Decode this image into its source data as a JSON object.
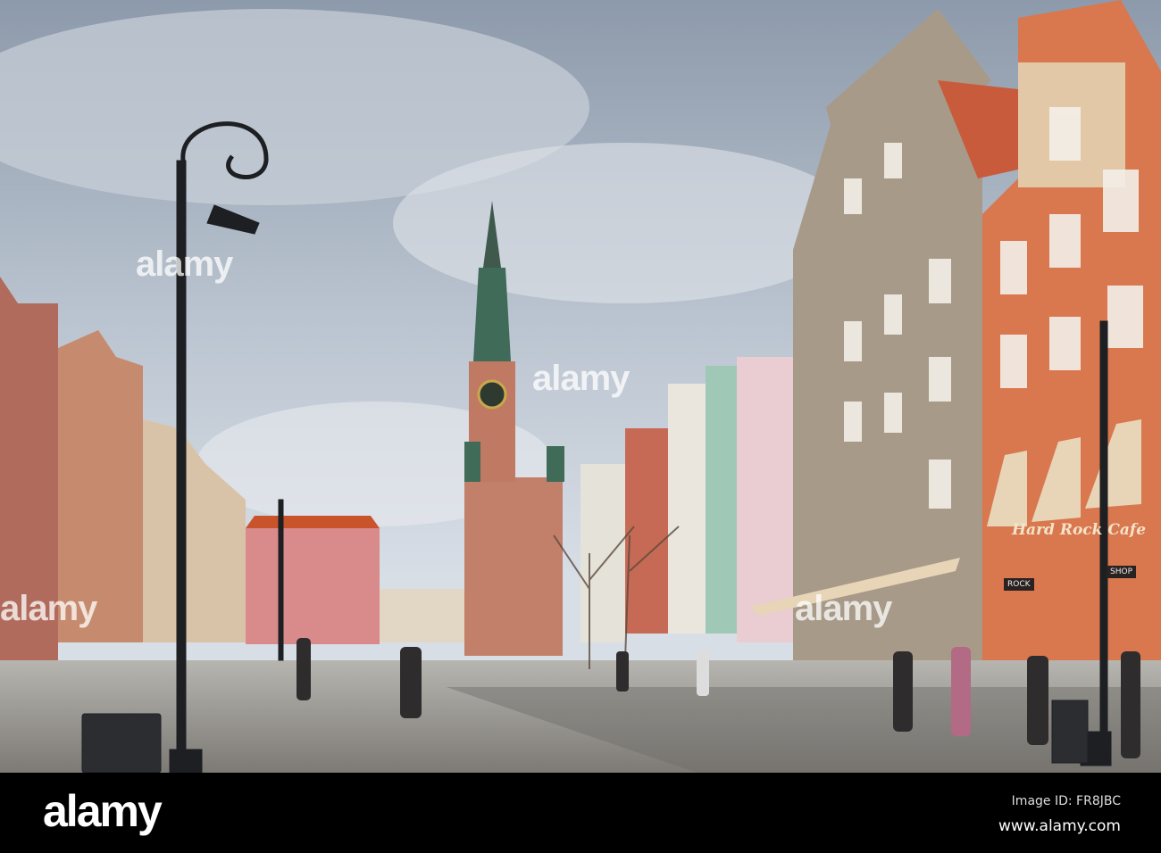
{
  "photo": {
    "watermark": "alamy",
    "storefront_sign": "Hard Rock Cafe",
    "store_labels": [
      "ROCK",
      "SHOP"
    ],
    "colors": {
      "sky": "#aab7c6",
      "pavement": "#9c9a96",
      "orange_facade": "#d9774f",
      "grey_facade": "#a89a88",
      "tower_brick": "#c2806a"
    }
  },
  "footer": {
    "logo": "alamy",
    "image_id": "Image ID: FR8JBC",
    "url": "www.alamy.com"
  }
}
